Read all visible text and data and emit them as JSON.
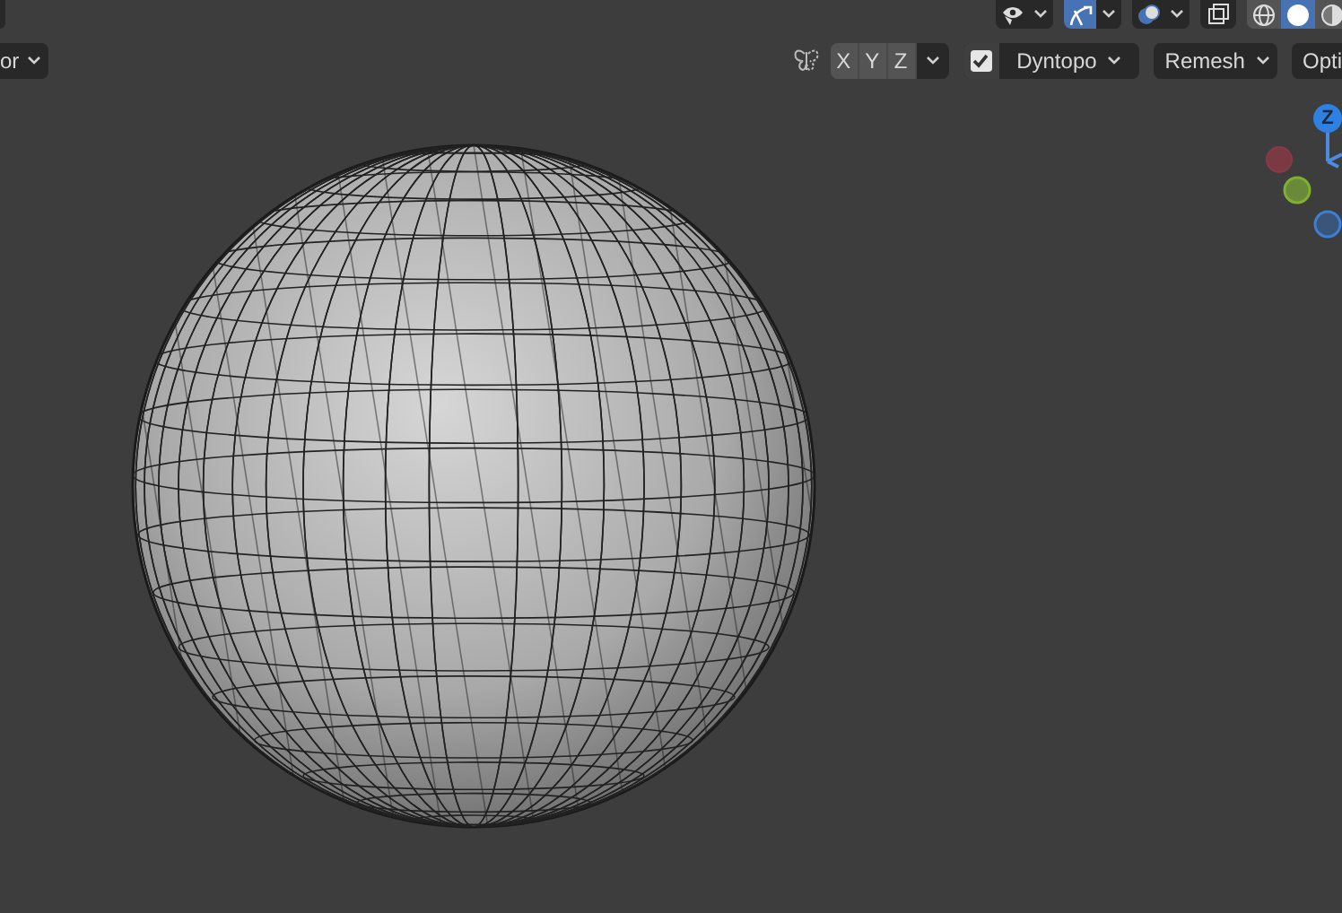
{
  "header_top": {
    "visibility_dropdown": {
      "selected": false
    },
    "gizmo_toggle": {
      "selected": true
    },
    "overlay_toggle": {
      "selected": false
    },
    "xray_toggle": {
      "selected": false
    },
    "shading_modes": [
      {
        "kind": "wire",
        "selected": false
      },
      {
        "kind": "solid",
        "selected": true
      },
      {
        "kind": "material",
        "selected": false
      }
    ]
  },
  "header_tools": {
    "left_dropdown": "or",
    "mirror_axes": [
      {
        "label": "X",
        "selected": false
      },
      {
        "label": "Y",
        "selected": false
      },
      {
        "label": "Z",
        "selected": false
      }
    ],
    "dyntopo": {
      "label": "Dyntopo",
      "checked": true
    },
    "remesh": "Remesh",
    "options": "Opti"
  },
  "navigation_gizmo": {
    "z_label": "Z"
  }
}
